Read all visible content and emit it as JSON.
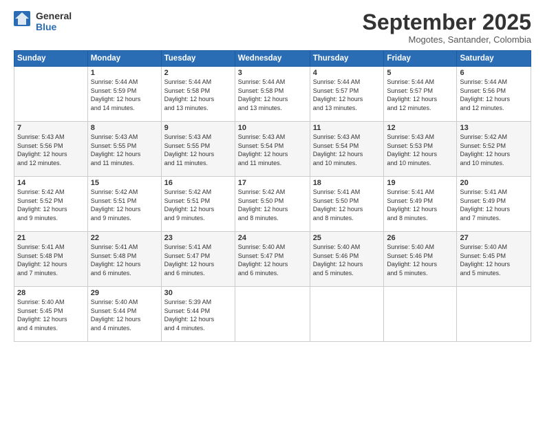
{
  "header": {
    "logo": {
      "line1": "General",
      "line2": "Blue"
    },
    "title": "September 2025",
    "location": "Mogotes, Santander, Colombia"
  },
  "days_header": [
    "Sunday",
    "Monday",
    "Tuesday",
    "Wednesday",
    "Thursday",
    "Friday",
    "Saturday"
  ],
  "weeks": [
    [
      {
        "day": "",
        "info": ""
      },
      {
        "day": "1",
        "info": "Sunrise: 5:44 AM\nSunset: 5:59 PM\nDaylight: 12 hours\nand 14 minutes."
      },
      {
        "day": "2",
        "info": "Sunrise: 5:44 AM\nSunset: 5:58 PM\nDaylight: 12 hours\nand 13 minutes."
      },
      {
        "day": "3",
        "info": "Sunrise: 5:44 AM\nSunset: 5:58 PM\nDaylight: 12 hours\nand 13 minutes."
      },
      {
        "day": "4",
        "info": "Sunrise: 5:44 AM\nSunset: 5:57 PM\nDaylight: 12 hours\nand 13 minutes."
      },
      {
        "day": "5",
        "info": "Sunrise: 5:44 AM\nSunset: 5:57 PM\nDaylight: 12 hours\nand 12 minutes."
      },
      {
        "day": "6",
        "info": "Sunrise: 5:44 AM\nSunset: 5:56 PM\nDaylight: 12 hours\nand 12 minutes."
      }
    ],
    [
      {
        "day": "7",
        "info": "Sunrise: 5:43 AM\nSunset: 5:56 PM\nDaylight: 12 hours\nand 12 minutes."
      },
      {
        "day": "8",
        "info": "Sunrise: 5:43 AM\nSunset: 5:55 PM\nDaylight: 12 hours\nand 11 minutes."
      },
      {
        "day": "9",
        "info": "Sunrise: 5:43 AM\nSunset: 5:55 PM\nDaylight: 12 hours\nand 11 minutes."
      },
      {
        "day": "10",
        "info": "Sunrise: 5:43 AM\nSunset: 5:54 PM\nDaylight: 12 hours\nand 11 minutes."
      },
      {
        "day": "11",
        "info": "Sunrise: 5:43 AM\nSunset: 5:54 PM\nDaylight: 12 hours\nand 10 minutes."
      },
      {
        "day": "12",
        "info": "Sunrise: 5:43 AM\nSunset: 5:53 PM\nDaylight: 12 hours\nand 10 minutes."
      },
      {
        "day": "13",
        "info": "Sunrise: 5:42 AM\nSunset: 5:52 PM\nDaylight: 12 hours\nand 10 minutes."
      }
    ],
    [
      {
        "day": "14",
        "info": "Sunrise: 5:42 AM\nSunset: 5:52 PM\nDaylight: 12 hours\nand 9 minutes."
      },
      {
        "day": "15",
        "info": "Sunrise: 5:42 AM\nSunset: 5:51 PM\nDaylight: 12 hours\nand 9 minutes."
      },
      {
        "day": "16",
        "info": "Sunrise: 5:42 AM\nSunset: 5:51 PM\nDaylight: 12 hours\nand 9 minutes."
      },
      {
        "day": "17",
        "info": "Sunrise: 5:42 AM\nSunset: 5:50 PM\nDaylight: 12 hours\nand 8 minutes."
      },
      {
        "day": "18",
        "info": "Sunrise: 5:41 AM\nSunset: 5:50 PM\nDaylight: 12 hours\nand 8 minutes."
      },
      {
        "day": "19",
        "info": "Sunrise: 5:41 AM\nSunset: 5:49 PM\nDaylight: 12 hours\nand 8 minutes."
      },
      {
        "day": "20",
        "info": "Sunrise: 5:41 AM\nSunset: 5:49 PM\nDaylight: 12 hours\nand 7 minutes."
      }
    ],
    [
      {
        "day": "21",
        "info": "Sunrise: 5:41 AM\nSunset: 5:48 PM\nDaylight: 12 hours\nand 7 minutes."
      },
      {
        "day": "22",
        "info": "Sunrise: 5:41 AM\nSunset: 5:48 PM\nDaylight: 12 hours\nand 6 minutes."
      },
      {
        "day": "23",
        "info": "Sunrise: 5:41 AM\nSunset: 5:47 PM\nDaylight: 12 hours\nand 6 minutes."
      },
      {
        "day": "24",
        "info": "Sunrise: 5:40 AM\nSunset: 5:47 PM\nDaylight: 12 hours\nand 6 minutes."
      },
      {
        "day": "25",
        "info": "Sunrise: 5:40 AM\nSunset: 5:46 PM\nDaylight: 12 hours\nand 5 minutes."
      },
      {
        "day": "26",
        "info": "Sunrise: 5:40 AM\nSunset: 5:46 PM\nDaylight: 12 hours\nand 5 minutes."
      },
      {
        "day": "27",
        "info": "Sunrise: 5:40 AM\nSunset: 5:45 PM\nDaylight: 12 hours\nand 5 minutes."
      }
    ],
    [
      {
        "day": "28",
        "info": "Sunrise: 5:40 AM\nSunset: 5:45 PM\nDaylight: 12 hours\nand 4 minutes."
      },
      {
        "day": "29",
        "info": "Sunrise: 5:40 AM\nSunset: 5:44 PM\nDaylight: 12 hours\nand 4 minutes."
      },
      {
        "day": "30",
        "info": "Sunrise: 5:39 AM\nSunset: 5:44 PM\nDaylight: 12 hours\nand 4 minutes."
      },
      {
        "day": "",
        "info": ""
      },
      {
        "day": "",
        "info": ""
      },
      {
        "day": "",
        "info": ""
      },
      {
        "day": "",
        "info": ""
      }
    ]
  ]
}
